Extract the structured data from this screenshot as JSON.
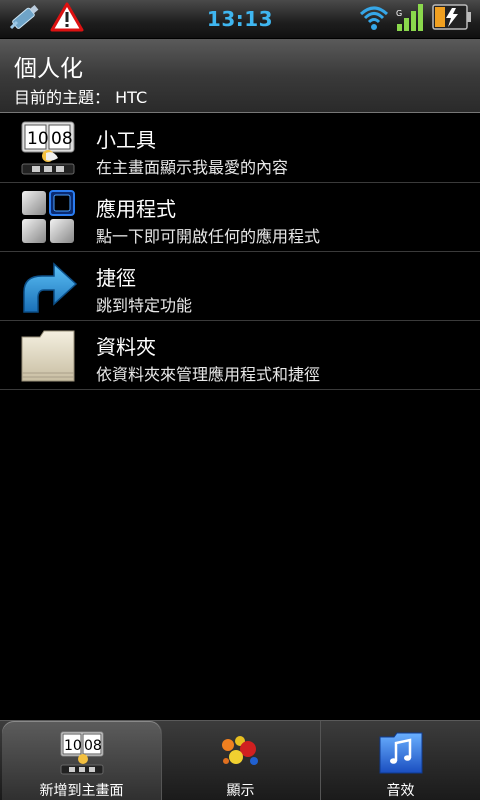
{
  "status_bar": {
    "time": "13:13",
    "icons": [
      "usb-debug-icon",
      "warning-icon",
      "wifi-icon",
      "signal-icon",
      "battery-charging-icon"
    ]
  },
  "header": {
    "title": "個人化",
    "subtitle": "目前的主題： HTC"
  },
  "list": {
    "items": [
      {
        "title": "小工具",
        "desc": "在主畫面顯示我最愛的內容",
        "icon": "widget-clock-icon"
      },
      {
        "title": "應用程式",
        "desc": "點一下即可開啟任何的應用程式",
        "icon": "app-grid-icon"
      },
      {
        "title": "捷徑",
        "desc": "跳到特定功能",
        "icon": "shortcut-arrow-icon"
      },
      {
        "title": "資料夾",
        "desc": "依資料夾來管理應用程式和捷徑",
        "icon": "folder-icon"
      }
    ]
  },
  "widget_clock_digits": [
    "10",
    "08"
  ],
  "tabs": [
    {
      "label": "新增到主畫面",
      "icon": "add-to-home-icon",
      "active": true
    },
    {
      "label": "顯示",
      "icon": "display-icon",
      "active": false
    },
    {
      "label": "音效",
      "icon": "sound-icon",
      "active": false
    }
  ],
  "colors": {
    "time": "#3fb6f0",
    "background": "#000000"
  }
}
